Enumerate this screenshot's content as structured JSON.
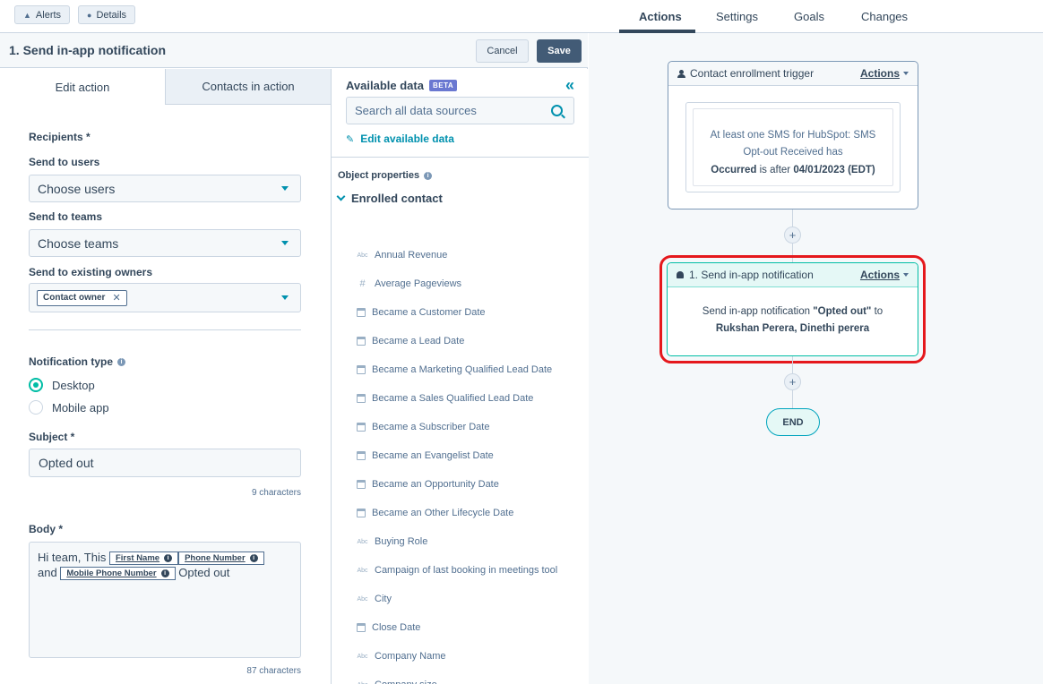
{
  "topbar": {
    "alerts_label": "Alerts",
    "details_label": "Details",
    "tabs": [
      {
        "label": "Actions"
      },
      {
        "label": "Settings"
      },
      {
        "label": "Goals"
      },
      {
        "label": "Changes"
      }
    ],
    "active_tab": "Actions"
  },
  "editor": {
    "title": "1. Send in-app notification",
    "cancel_label": "Cancel",
    "save_label": "Save",
    "tabs": [
      {
        "label": "Edit action"
      },
      {
        "label": "Contacts in action"
      }
    ],
    "recipients_label": "Recipients *",
    "send_to_users_label": "Send to users",
    "send_to_users_value": "Choose users",
    "send_to_teams_label": "Send to teams",
    "send_to_teams_value": "Choose teams",
    "send_to_owners_label": "Send to existing owners",
    "owner_chip": "Contact owner",
    "notification_type_label": "Notification type",
    "option_desktop": "Desktop",
    "option_mobile": "Mobile app",
    "selected_type": "Desktop",
    "subject_label": "Subject *",
    "subject_value": "Opted out",
    "subject_count": "9 characters",
    "body_label": "Body *",
    "body_text_1": "Hi team, This",
    "body_token_1": "First Name",
    "body_token_2": "Phone Number",
    "body_text_2": "and",
    "body_token_3": "Mobile Phone Number",
    "body_text_3": "Opted out",
    "body_count": "87 characters"
  },
  "data_panel": {
    "title": "Available data",
    "badge": "BETA",
    "search_placeholder": "Search all data sources",
    "edit_link": "Edit available data",
    "section_label": "Object properties",
    "group_label": "Enrolled contact",
    "properties": [
      {
        "label": "Annual Revenue",
        "icon": "text"
      },
      {
        "label": "Average Pageviews",
        "icon": "number"
      },
      {
        "label": "Became a Customer Date",
        "icon": "date"
      },
      {
        "label": "Became a Lead Date",
        "icon": "date"
      },
      {
        "label": "Became a Marketing Qualified Lead Date",
        "icon": "date"
      },
      {
        "label": "Became a Sales Qualified Lead Date",
        "icon": "date"
      },
      {
        "label": "Became a Subscriber Date",
        "icon": "date"
      },
      {
        "label": "Became an Evangelist Date",
        "icon": "date"
      },
      {
        "label": "Became an Opportunity Date",
        "icon": "date"
      },
      {
        "label": "Became an Other Lifecycle Date",
        "icon": "date"
      },
      {
        "label": "Buying Role",
        "icon": "text"
      },
      {
        "label": "Campaign of last booking in meetings tool",
        "icon": "text"
      },
      {
        "label": "City",
        "icon": "text"
      },
      {
        "label": "Close Date",
        "icon": "date"
      },
      {
        "label": "Company Name",
        "icon": "text"
      },
      {
        "label": "Company size",
        "icon": "text"
      }
    ],
    "text_icon_glyph": "Abc",
    "number_icon_glyph": "#"
  },
  "canvas": {
    "trigger": {
      "title": "Contact enrollment trigger",
      "actions_label": "Actions",
      "condition_line_1": "At least one SMS for HubSpot: SMS",
      "condition_line_2": "Opt-out Received has",
      "occurred_bold": "Occurred",
      "occurred_mid": " is after ",
      "occurred_date": "04/01/2023 (EDT)"
    },
    "action": {
      "title": "1. Send in-app notification",
      "actions_label": "Actions",
      "body_prefix": "Send in-app notification ",
      "body_subject": "\"Opted out\"",
      "body_to": " to",
      "recipients": "Rukshan Perera, Dinethi perera"
    },
    "plus_glyph": "+",
    "end_label": "END"
  },
  "colors": {
    "accent_teal": "#00bda5",
    "link_blue": "#0091ae",
    "highlight_red": "#e5181c",
    "save_bg": "#425b76"
  }
}
